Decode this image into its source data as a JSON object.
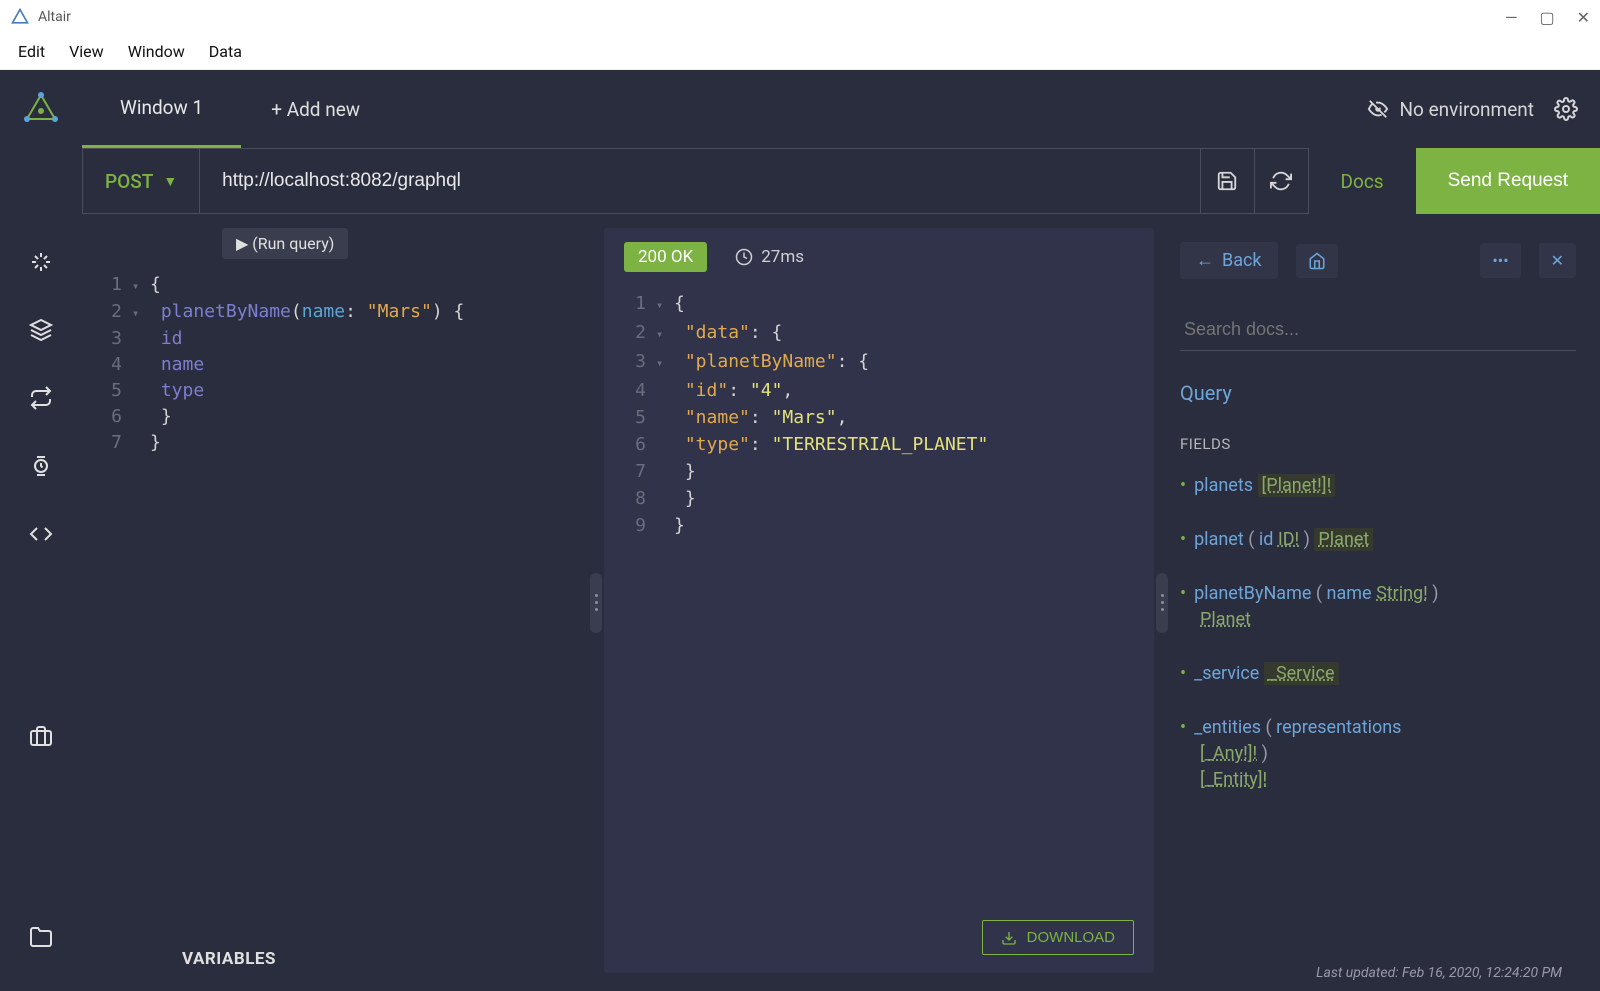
{
  "window": {
    "title": "Altair"
  },
  "menubar": [
    "Edit",
    "View",
    "Window",
    "Data"
  ],
  "tabs": {
    "active": "Window 1",
    "add_label": "+ Add new"
  },
  "environment": {
    "label": "No environment"
  },
  "request_bar": {
    "method": "POST",
    "url": "http://localhost:8082/graphql",
    "docs_label": "Docs",
    "send_label": "Send Request"
  },
  "run_label": "▶ (Run query)",
  "query_lines": [
    {
      "n": 1,
      "fold": "▾",
      "html": "{"
    },
    {
      "n": 2,
      "fold": "▾",
      "html": "  <span class='tok-field'>planetByName</span><span class='tok-punct'>(</span><span class='tok-arg'>name</span><span class='tok-punct'>: </span><span class='tok-str'>\"Mars\"</span><span class='tok-punct'>) {</span>"
    },
    {
      "n": 3,
      "fold": "",
      "html": "    <span class='tok-field'>id</span>"
    },
    {
      "n": 4,
      "fold": "",
      "html": "    <span class='tok-field'>name</span>"
    },
    {
      "n": 5,
      "fold": "",
      "html": "    <span class='tok-field'>type</span>"
    },
    {
      "n": 6,
      "fold": "",
      "html": "  }"
    },
    {
      "n": 7,
      "fold": "",
      "html": "}"
    }
  ],
  "response": {
    "status": "200 OK",
    "time": "27ms",
    "download_label": "DOWNLOAD",
    "lines": [
      {
        "n": 1,
        "fold": "▾",
        "html": "{"
      },
      {
        "n": 2,
        "fold": "▾",
        "html": "  <span class='tok-key'>\"data\"</span>: {"
      },
      {
        "n": 3,
        "fold": "▾",
        "html": "    <span class='tok-key'>\"planetByName\"</span>: {"
      },
      {
        "n": 4,
        "fold": "",
        "html": "      <span class='tok-key'>\"id\"</span>: <span class='tok-val'>\"4\"</span>,"
      },
      {
        "n": 5,
        "fold": "",
        "html": "      <span class='tok-key'>\"name\"</span>: <span class='tok-val'>\"Mars\"</span>,"
      },
      {
        "n": 6,
        "fold": "",
        "html": "      <span class='tok-key'>\"type\"</span>: <span class='tok-val'>\"TERRESTRIAL_PLANET\"</span>"
      },
      {
        "n": 7,
        "fold": "",
        "html": "    }"
      },
      {
        "n": 8,
        "fold": "",
        "html": "  }"
      },
      {
        "n": 9,
        "fold": "",
        "html": "}"
      }
    ]
  },
  "docs": {
    "back_label": "Back",
    "search_placeholder": "Search docs...",
    "type_title": "Query",
    "fields_heading": "FIELDS",
    "fields": [
      {
        "name": "planets",
        "args": [],
        "return": "[Planet!]!",
        "boxed": true
      },
      {
        "name": "planet",
        "args": [
          {
            "name": "id",
            "type": "ID!"
          }
        ],
        "return": "Planet",
        "boxed": true
      },
      {
        "name": "planetByName",
        "args": [
          {
            "name": "name",
            "type": "String!"
          }
        ],
        "return": "Planet",
        "wrap": true
      },
      {
        "name": "_service",
        "args": [],
        "return": "_Service",
        "boxed": true
      },
      {
        "name": "_entities",
        "args": [
          {
            "name": "representations",
            "type": "[_Any!]!",
            "wrap": true
          }
        ],
        "return": "[_Entity]!",
        "wrap": true
      }
    ],
    "last_updated": "Last updated: Feb 16, 2020, 12:24:20 PM"
  },
  "variables_label": "VARIABLES"
}
